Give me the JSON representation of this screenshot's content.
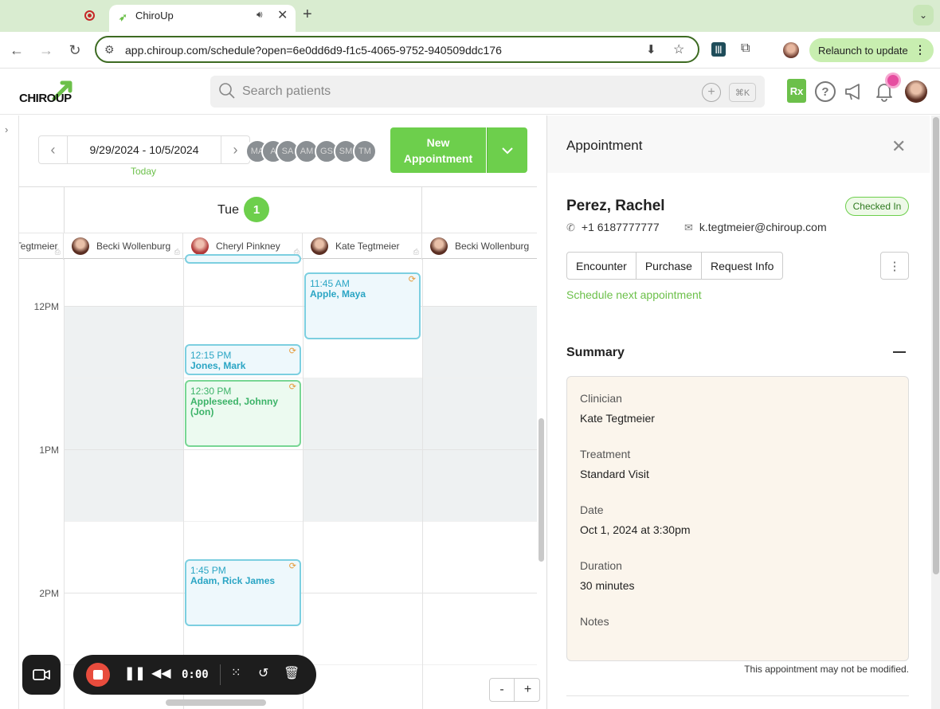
{
  "browser": {
    "tab_title": "ChiroUp",
    "url": "app.chiroup.com/schedule?open=6e0dd6d9-f1c5-4065-9752-940509ddc176",
    "relaunch_label": "Relaunch to update"
  },
  "header": {
    "logo_text_a": "CHIRO",
    "logo_text_b": "UP",
    "search_placeholder": "Search patients",
    "shortcut": "⌘K",
    "rx_label": "Rx"
  },
  "calendar": {
    "date_range": "9/29/2024 - 10/5/2024",
    "today_label": "Today",
    "chips": [
      "MA",
      "A",
      "SA",
      "AM",
      "GS",
      "SM",
      "TM"
    ],
    "new_appointment_line1": "New",
    "new_appointment_line2": "Appointment",
    "day_label": "Tue",
    "day_number": "1",
    "providers": [
      "Kate Tegtmeier",
      "Becki Wollenburg",
      "Cheryl Pinkney",
      "Kate Tegtmeier",
      "Becki Wollenburg"
    ],
    "hours": [
      "12PM",
      "1PM",
      "2PM"
    ],
    "appointments": [
      {
        "time": "11:45 AM",
        "patient": "Apple, Maya"
      },
      {
        "time": "12:15 PM",
        "patient": "Jones, Mark"
      },
      {
        "time": "12:30 PM",
        "patient": "Appleseed, Johnny (Jon)"
      },
      {
        "time": "1:45 PM",
        "patient": "Adam, Rick James"
      }
    ],
    "zoom_minus": "-",
    "zoom_plus": "+"
  },
  "recorder": {
    "time": "0:00"
  },
  "panel": {
    "title": "Appointment",
    "patient_name": "Perez, Rachel",
    "status": "Checked In",
    "phone": "+1 6187777777",
    "email": "k.tegtmeier@chiroup.com",
    "actions": [
      "Encounter",
      "Purchase",
      "Request Info"
    ],
    "schedule_next": "Schedule next appointment",
    "summary_title": "Summary",
    "fields": [
      {
        "label": "Clinician",
        "value": "Kate Tegtmeier"
      },
      {
        "label": "Treatment",
        "value": "Standard Visit"
      },
      {
        "label": "Date",
        "value": "Oct 1, 2024 at 3:30pm"
      },
      {
        "label": "Duration",
        "value": "30 minutes"
      },
      {
        "label": "Notes",
        "value": ""
      }
    ],
    "footer_note": "This appointment may not be modified."
  }
}
